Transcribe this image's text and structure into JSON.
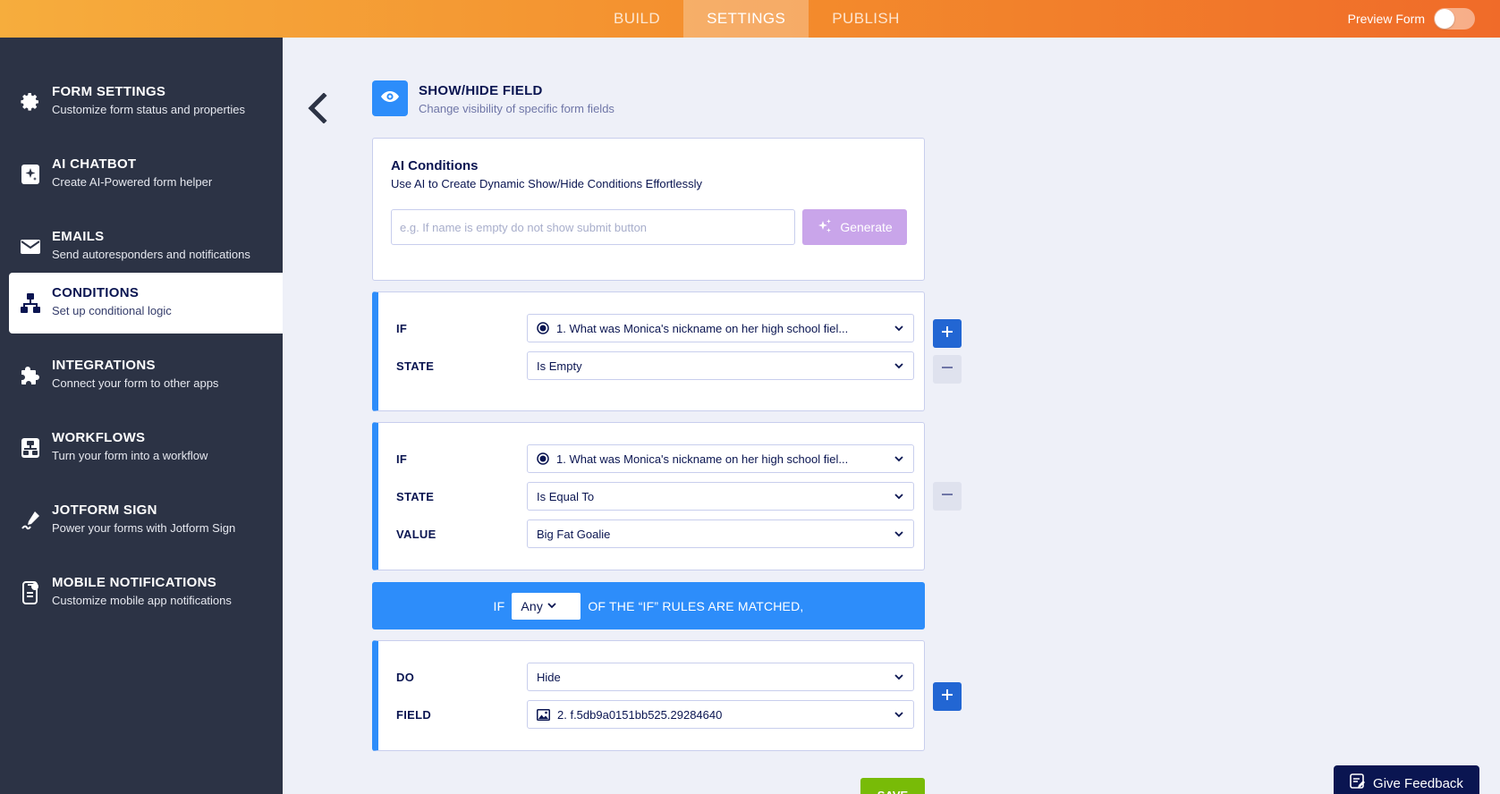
{
  "topbar": {
    "tabs": [
      {
        "label": "BUILD"
      },
      {
        "label": "SETTINGS"
      },
      {
        "label": "PUBLISH"
      }
    ],
    "active_tab": "SETTINGS",
    "preview_label": "Preview Form",
    "preview_enabled": false
  },
  "sidebar": {
    "items": [
      {
        "title": "FORM SETTINGS",
        "subtitle": "Customize form status and properties",
        "icon": "gear-icon"
      },
      {
        "title": "AI CHATBOT",
        "subtitle": "Create AI-Powered form helper",
        "icon": "ai-chatbot-icon"
      },
      {
        "title": "EMAILS",
        "subtitle": "Send autoresponders and notifications",
        "icon": "envelope-icon"
      },
      {
        "title": "CONDITIONS",
        "subtitle": "Set up conditional logic",
        "icon": "hierarchy-icon"
      },
      {
        "title": "INTEGRATIONS",
        "subtitle": "Connect your form to other apps",
        "icon": "puzzle-icon"
      },
      {
        "title": "WORKFLOWS",
        "subtitle": "Turn your form into a workflow",
        "icon": "workflow-icon"
      },
      {
        "title": "JOTFORM SIGN",
        "subtitle": "Power your forms with Jotform Sign",
        "icon": "pen-icon"
      },
      {
        "title": "MOBILE NOTIFICATIONS",
        "subtitle": "Customize mobile app notifications",
        "icon": "mobile-icon"
      }
    ],
    "active_item": "CONDITIONS"
  },
  "header": {
    "title": "SHOW/HIDE FIELD",
    "subtitle": "Change visibility of specific form fields",
    "icon": "eye-icon"
  },
  "ai": {
    "title": "AI Conditions",
    "subtitle": "Use AI to Create Dynamic Show/Hide Conditions Effortlessly",
    "placeholder": "e.g. If name is empty do not show submit button",
    "value": "",
    "generate_label": "Generate"
  },
  "rules": [
    {
      "if_label": "IF",
      "if_value": "1. What was Monica's nickname on her high school fiel...",
      "state_label": "STATE",
      "state_value": "Is Empty"
    },
    {
      "if_label": "IF",
      "if_value": "1. What was Monica's nickname on her high school fiel...",
      "state_label": "STATE",
      "state_value": "Is Equal To",
      "value_label": "VALUE",
      "value_value": "Big Fat Goalie"
    }
  ],
  "match": {
    "prefix": "IF",
    "selected": "Any",
    "suffix": "OF THE “IF” RULES ARE MATCHED,"
  },
  "action": {
    "do_label": "DO",
    "do_value": "Hide",
    "field_label": "FIELD",
    "field_value": "2. f.5db9a0151bb525.29284640"
  },
  "save_label": "SAVE",
  "feedback_label": "Give Feedback",
  "colors": {
    "topbar_start": "#f6ad3d",
    "topbar_end": "#f06b29",
    "sidebar_bg": "#2c3345",
    "accent_blue": "#2d8dfa",
    "plus_button": "#2266d3",
    "generate_button": "#c9a5ea",
    "save_button": "#78bb07",
    "feedback_button": "#0a1551"
  }
}
